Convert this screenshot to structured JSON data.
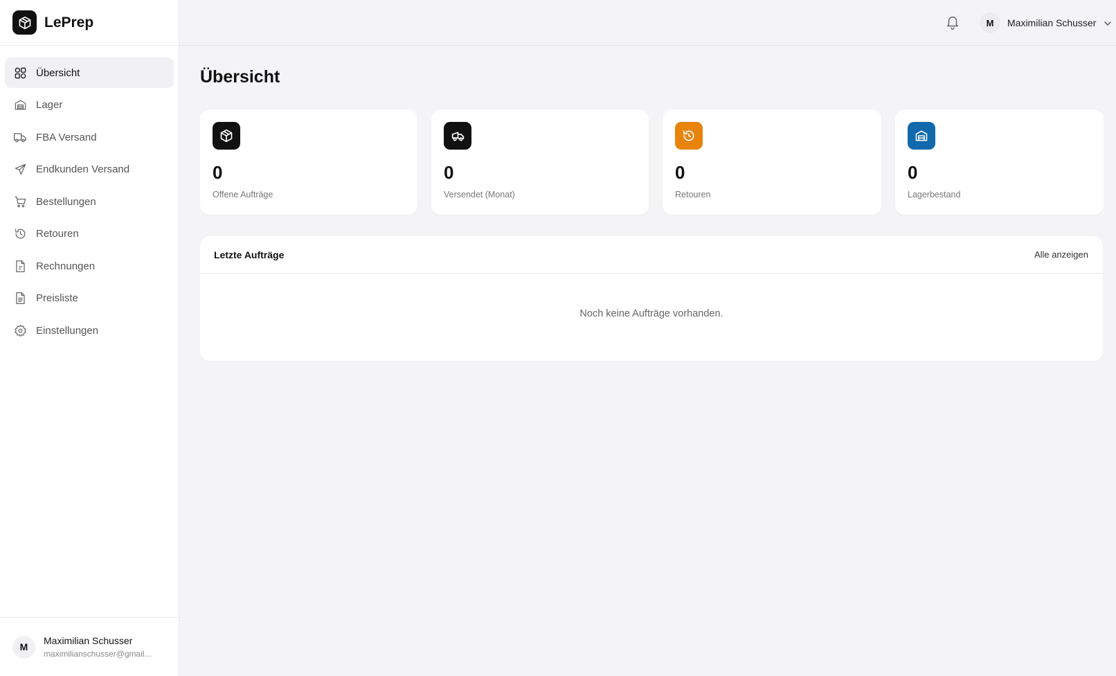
{
  "brand": {
    "name": "LePrep"
  },
  "sidebar": {
    "items": [
      {
        "label": "Übersicht",
        "icon": "dashboard-icon",
        "active": true
      },
      {
        "label": "Lager",
        "icon": "warehouse-icon"
      },
      {
        "label": "FBA Versand",
        "icon": "truck-icon"
      },
      {
        "label": "Endkunden Versand",
        "icon": "send-icon"
      },
      {
        "label": "Bestellungen",
        "icon": "cart-icon"
      },
      {
        "label": "Retouren",
        "icon": "return-icon"
      },
      {
        "label": "Rechnungen",
        "icon": "invoice-icon"
      },
      {
        "label": "Preisliste",
        "icon": "pricelist-icon"
      },
      {
        "label": "Einstellungen",
        "icon": "settings-icon"
      }
    ],
    "user": {
      "initial": "M",
      "name": "Maximilian Schusser",
      "email": "maximilianschusser@gmail..."
    }
  },
  "header": {
    "user_initial": "M",
    "user_name": "Maximilian Schusser"
  },
  "main": {
    "title": "Übersicht",
    "stats": [
      {
        "value": "0",
        "label": "Offene Aufträge",
        "icon": "package-icon",
        "color": "#111111"
      },
      {
        "value": "0",
        "label": "Versendet (Monat)",
        "icon": "truck-icon",
        "color": "#111111"
      },
      {
        "value": "0",
        "label": "Retouren",
        "icon": "return-icon",
        "color": "#e8830c"
      },
      {
        "value": "0",
        "label": "Lagerbestand",
        "icon": "warehouse-icon",
        "color": "#1269ac"
      }
    ],
    "orders": {
      "title": "Letzte Aufträge",
      "link": "Alle anzeigen",
      "empty": "Noch keine Aufträge vorhanden."
    }
  }
}
